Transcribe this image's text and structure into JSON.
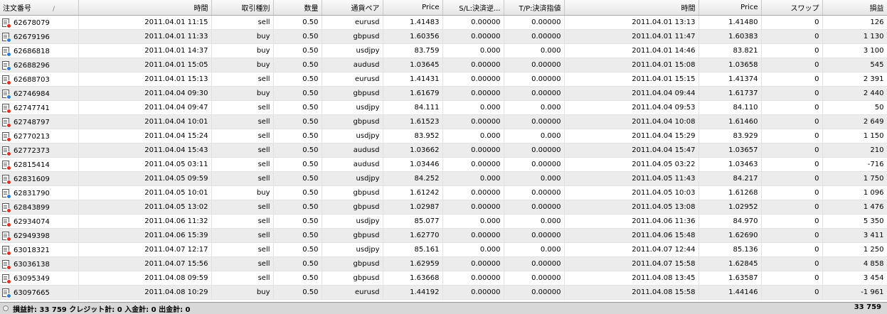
{
  "columns": [
    "注文番号",
    "時間",
    "取引種別",
    "数量",
    "通貨ペア",
    "Price",
    "S/L:決済逆...",
    "T/P:決済指値",
    "時間",
    "Price",
    "スワップ",
    "損益"
  ],
  "sort_indicator": "/",
  "rows": [
    {
      "ticket": "62678079",
      "open_time": "2011.04.01 11:15",
      "type": "sell",
      "size": "0.50",
      "item": "eurusd",
      "open_price": "1.41483",
      "sl": "0.00000",
      "tp": "0.00000",
      "close_time": "2011.04.01 13:13",
      "close_price": "1.41480",
      "swap": "0",
      "profit": "126"
    },
    {
      "ticket": "62679196",
      "open_time": "2011.04.01 11:33",
      "type": "buy",
      "size": "0.50",
      "item": "gbpusd",
      "open_price": "1.60356",
      "sl": "0.00000",
      "tp": "0.00000",
      "close_time": "2011.04.01 11:47",
      "close_price": "1.60383",
      "swap": "0",
      "profit": "1 130"
    },
    {
      "ticket": "62686818",
      "open_time": "2011.04.01 14:37",
      "type": "buy",
      "size": "0.50",
      "item": "usdjpy",
      "open_price": "83.759",
      "sl": "0.000",
      "tp": "0.000",
      "close_time": "2011.04.01 14:46",
      "close_price": "83.821",
      "swap": "0",
      "profit": "3 100"
    },
    {
      "ticket": "62688296",
      "open_time": "2011.04.01 15:05",
      "type": "buy",
      "size": "0.50",
      "item": "audusd",
      "open_price": "1.03645",
      "sl": "0.00000",
      "tp": "0.00000",
      "close_time": "2011.04.01 15:08",
      "close_price": "1.03658",
      "swap": "0",
      "profit": "545"
    },
    {
      "ticket": "62688703",
      "open_time": "2011.04.01 15:13",
      "type": "sell",
      "size": "0.50",
      "item": "eurusd",
      "open_price": "1.41431",
      "sl": "0.00000",
      "tp": "0.00000",
      "close_time": "2011.04.01 15:15",
      "close_price": "1.41374",
      "swap": "0",
      "profit": "2 391"
    },
    {
      "ticket": "62746984",
      "open_time": "2011.04.04 09:30",
      "type": "buy",
      "size": "0.50",
      "item": "gbpusd",
      "open_price": "1.61679",
      "sl": "0.00000",
      "tp": "0.00000",
      "close_time": "2011.04.04 09:44",
      "close_price": "1.61737",
      "swap": "0",
      "profit": "2 440"
    },
    {
      "ticket": "62747741",
      "open_time": "2011.04.04 09:47",
      "type": "sell",
      "size": "0.50",
      "item": "usdjpy",
      "open_price": "84.111",
      "sl": "0.000",
      "tp": "0.000",
      "close_time": "2011.04.04 09:53",
      "close_price": "84.110",
      "swap": "0",
      "profit": "50"
    },
    {
      "ticket": "62748797",
      "open_time": "2011.04.04 10:01",
      "type": "sell",
      "size": "0.50",
      "item": "gbpusd",
      "open_price": "1.61523",
      "sl": "0.00000",
      "tp": "0.00000",
      "close_time": "2011.04.04 10:08",
      "close_price": "1.61460",
      "swap": "0",
      "profit": "2 649"
    },
    {
      "ticket": "62770213",
      "open_time": "2011.04.04 15:24",
      "type": "sell",
      "size": "0.50",
      "item": "usdjpy",
      "open_price": "83.952",
      "sl": "0.000",
      "tp": "0.000",
      "close_time": "2011.04.04 15:29",
      "close_price": "83.929",
      "swap": "0",
      "profit": "1 150"
    },
    {
      "ticket": "62772373",
      "open_time": "2011.04.04 15:43",
      "type": "sell",
      "size": "0.50",
      "item": "audusd",
      "open_price": "1.03662",
      "sl": "0.00000",
      "tp": "0.00000",
      "close_time": "2011.04.04 15:47",
      "close_price": "1.03657",
      "swap": "0",
      "profit": "210"
    },
    {
      "ticket": "62815414",
      "open_time": "2011.04.05 03:11",
      "type": "sell",
      "size": "0.50",
      "item": "audusd",
      "open_price": "1.03446",
      "sl": "0.00000",
      "tp": "0.00000",
      "close_time": "2011.04.05 03:22",
      "close_price": "1.03463",
      "swap": "0",
      "profit": "-716"
    },
    {
      "ticket": "62831609",
      "open_time": "2011.04.05 09:59",
      "type": "sell",
      "size": "0.50",
      "item": "usdjpy",
      "open_price": "84.252",
      "sl": "0.000",
      "tp": "0.000",
      "close_time": "2011.04.05 11:43",
      "close_price": "84.217",
      "swap": "0",
      "profit": "1 750"
    },
    {
      "ticket": "62831790",
      "open_time": "2011.04.05 10:01",
      "type": "buy",
      "size": "0.50",
      "item": "gbpusd",
      "open_price": "1.61242",
      "sl": "0.00000",
      "tp": "0.00000",
      "close_time": "2011.04.05 10:03",
      "close_price": "1.61268",
      "swap": "0",
      "profit": "1 096"
    },
    {
      "ticket": "62843899",
      "open_time": "2011.04.05 13:02",
      "type": "sell",
      "size": "0.50",
      "item": "gbpusd",
      "open_price": "1.02987",
      "sl": "0.00000",
      "tp": "0.00000",
      "close_time": "2011.04.05 13:08",
      "close_price": "1.02952",
      "swap": "0",
      "profit": "1 476"
    },
    {
      "ticket": "62934074",
      "open_time": "2011.04.06 11:32",
      "type": "sell",
      "size": "0.50",
      "item": "usdjpy",
      "open_price": "85.077",
      "sl": "0.000",
      "tp": "0.000",
      "close_time": "2011.04.06 11:36",
      "close_price": "84.970",
      "swap": "0",
      "profit": "5 350"
    },
    {
      "ticket": "62949398",
      "open_time": "2011.04.06 15:39",
      "type": "sell",
      "size": "0.50",
      "item": "gbpusd",
      "open_price": "1.62770",
      "sl": "0.00000",
      "tp": "0.00000",
      "close_time": "2011.04.06 15:48",
      "close_price": "1.62690",
      "swap": "0",
      "profit": "3 411"
    },
    {
      "ticket": "63018321",
      "open_time": "2011.04.07 12:17",
      "type": "sell",
      "size": "0.50",
      "item": "usdjpy",
      "open_price": "85.161",
      "sl": "0.000",
      "tp": "0.000",
      "close_time": "2011.04.07 12:44",
      "close_price": "85.136",
      "swap": "0",
      "profit": "1 250"
    },
    {
      "ticket": "63036138",
      "open_time": "2011.04.07 15:56",
      "type": "sell",
      "size": "0.50",
      "item": "gbpusd",
      "open_price": "1.62959",
      "sl": "0.00000",
      "tp": "0.00000",
      "close_time": "2011.04.07 15:58",
      "close_price": "1.62845",
      "swap": "0",
      "profit": "4 858"
    },
    {
      "ticket": "63095349",
      "open_time": "2011.04.08 09:59",
      "type": "sell",
      "size": "0.50",
      "item": "gbpusd",
      "open_price": "1.63668",
      "sl": "0.00000",
      "tp": "0.00000",
      "close_time": "2011.04.08 13:45",
      "close_price": "1.63587",
      "swap": "0",
      "profit": "3 454"
    },
    {
      "ticket": "63097665",
      "open_time": "2011.04.08 10:29",
      "type": "buy",
      "size": "0.50",
      "item": "eurusd",
      "open_price": "1.44192",
      "sl": "0.00000",
      "tp": "0.00000",
      "close_time": "2011.04.08 15:58",
      "close_price": "1.44146",
      "swap": "0",
      "profit": "-1 961"
    }
  ],
  "footer": {
    "summary": "損益計: 33 759  クレジット計: 0  入金計: 0  出金計: 0",
    "total_profit": "33 759"
  },
  "colors": {
    "sell_marker": "#e03020",
    "buy_marker": "#2a7fd4",
    "alt_row": "#ececec"
  }
}
